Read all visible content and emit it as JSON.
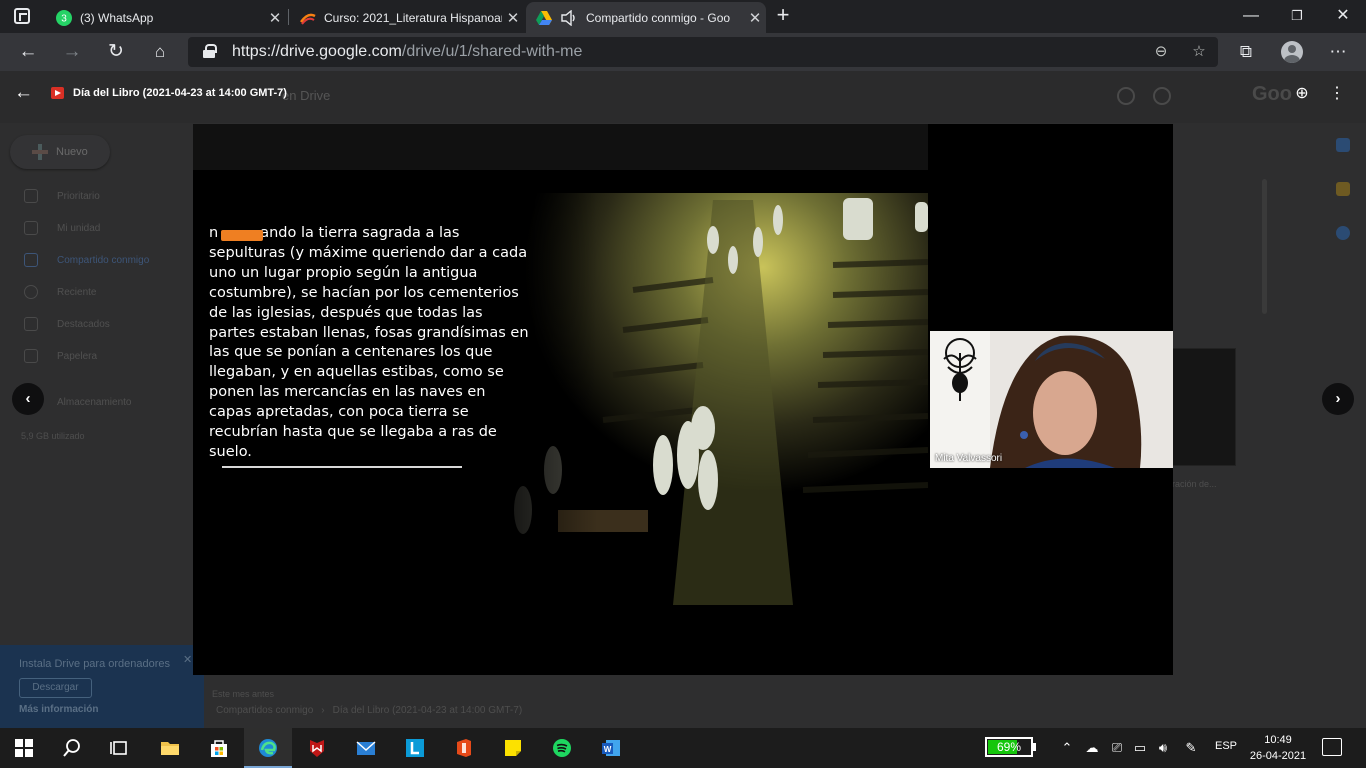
{
  "browser": {
    "tabs": [
      {
        "title": "(3) WhatsApp",
        "badge": "3",
        "icon": "whatsapp-icon"
      },
      {
        "title": "Curso: 2021_Literatura Hispanoam",
        "icon": "moodle-icon"
      },
      {
        "title": "Compartido conmigo - Goo",
        "icon": "google-drive-icon",
        "audio": true
      }
    ],
    "url_host": "https://drive.google.com",
    "url_path": "/drive/u/1/shared-with-me"
  },
  "preview": {
    "file_title": "Día del Libro (2021-04-23 at 14:00 GMT-7)"
  },
  "slide": {
    "visible_prefix": "n",
    "text": "ando la tierra sagrada a las\nsepulturas (y máxime queriendo dar a cada\nuno un lugar propio según la antigua\ncostumbre), se hacían por los cementerios\nde las iglesias, después que todas las\npartes estaban llenas, fosas grandísimas en\nlas que se ponían a centenares los que\nllegaban, y en aquellas estibas, como se\nponen las mercancías en las naves en\ncapas apretadas, con poca tierra se\nrecubrían hasta que se llegaba a ras de\nsuelo."
  },
  "participant": {
    "name": "Mita Valvassori"
  },
  "drive_background": {
    "partial_title": "en Drive",
    "google_partial": "Goo",
    "new_button": "Nuevo",
    "sidebar": [
      "Prioritario",
      "Mi unidad",
      "Compartido conmigo",
      "Reciente",
      "Destacados",
      "Papelera"
    ],
    "storage_label": "Almacenamiento",
    "storage_used": "5,9 GB utilizado",
    "promo_title": "Instala Drive para ordenadores",
    "promo_button": "Descargar",
    "promo_link": "Más información",
    "files_heading": "Este mes antes",
    "breadcrumb_root": "Compartidos conmigo",
    "breadcrumb_file": "Día del Libro (2021-04-23 at 14:00 GMT-7)",
    "thumb_caption": "ración de..."
  },
  "taskbar": {
    "battery": "69%",
    "battery_level": 0.69,
    "language": "ESP",
    "time": "10:49",
    "date": "26-04-2021"
  },
  "colors": {
    "redaction": "#ef7f22",
    "battery_green": "#16c60c"
  }
}
